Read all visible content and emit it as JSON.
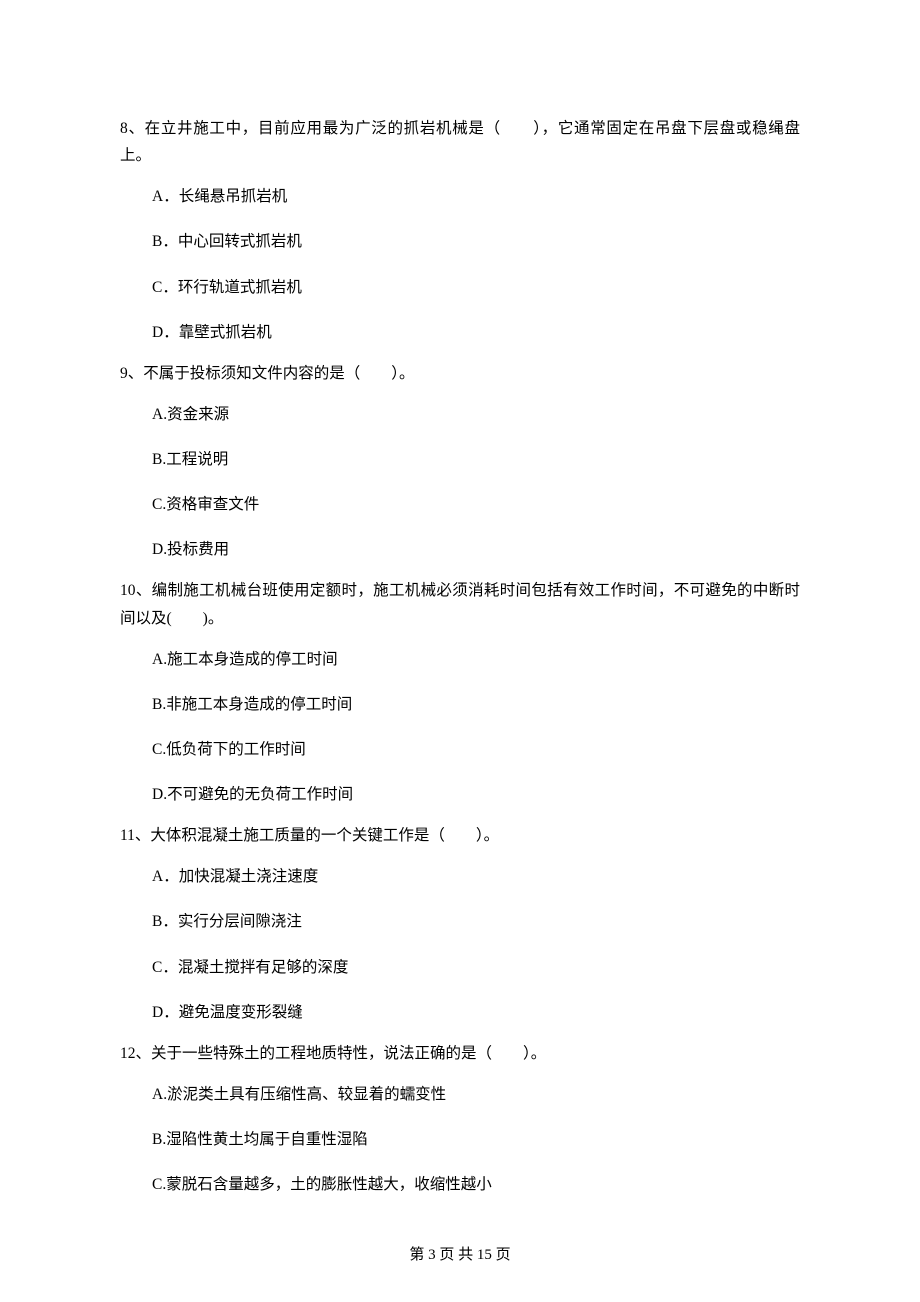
{
  "questions": [
    {
      "text": "8、在立井施工中，目前应用最为广泛的抓岩机械是（　　），它通常固定在吊盘下层盘或稳绳盘上。",
      "options": [
        "A．长绳悬吊抓岩机",
        "B．中心回转式抓岩机",
        "C．环行轨道式抓岩机",
        "D．靠壁式抓岩机"
      ]
    },
    {
      "text": "9、不属于投标须知文件内容的是（　　）。",
      "options": [
        "A.资金来源",
        "B.工程说明",
        "C.资格审查文件",
        "D.投标费用"
      ]
    },
    {
      "text": "10、编制施工机械台班使用定额时，施工机械必须消耗时间包括有效工作时间，不可避免的中断时间以及(　　)。",
      "options": [
        "A.施工本身造成的停工时间",
        "B.非施工本身造成的停工时间",
        "C.低负荷下的工作时间",
        "D.不可避免的无负荷工作时间"
      ]
    },
    {
      "text": "11、大体积混凝土施工质量的一个关键工作是（　　）。",
      "options": [
        "A．加快混凝土浇注速度",
        "B．实行分层间隙浇注",
        "C．混凝土搅拌有足够的深度",
        "D．避免温度变形裂缝"
      ]
    },
    {
      "text": "12、关于一些特殊土的工程地质特性，说法正确的是（　　）。",
      "options": [
        "A.淤泥类土具有压缩性高、较显着的蠕变性",
        "B.湿陷性黄土均属于自重性湿陷",
        "C.蒙脱石含量越多，土的膨胀性越大，收缩性越小"
      ]
    }
  ],
  "footer": "第 3 页 共 15 页"
}
